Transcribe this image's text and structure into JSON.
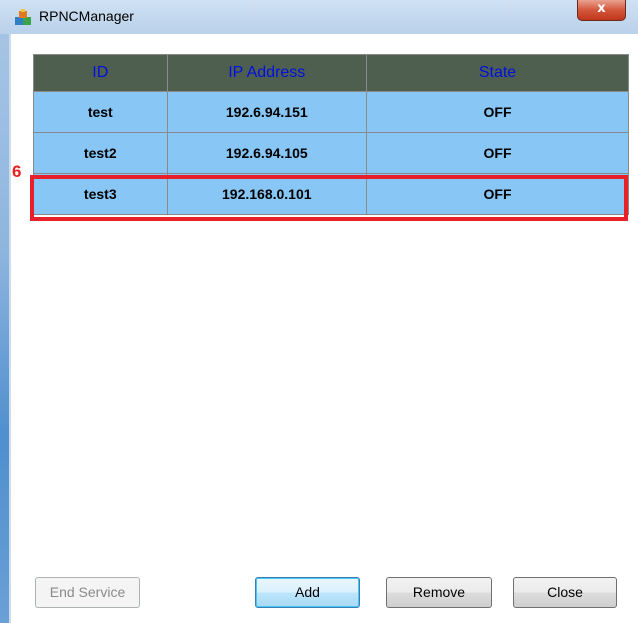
{
  "window": {
    "title": "RPNCManager",
    "close_glyph": "x"
  },
  "table": {
    "headers": [
      "ID",
      "IP Address",
      "State"
    ],
    "rows": [
      {
        "id": "test",
        "ip": "192.6.94.151",
        "state": "OFF"
      },
      {
        "id": "test2",
        "ip": "192.6.94.105",
        "state": "OFF"
      },
      {
        "id": "test3",
        "ip": "192.168.0.101",
        "state": "OFF"
      }
    ]
  },
  "annotation": {
    "step_number": "6"
  },
  "buttons": {
    "end_service": "End Service",
    "add": "Add",
    "remove": "Remove",
    "close": "Close"
  },
  "colors": {
    "header_bg": "#4f5f4f",
    "header_text": "#0010e0",
    "row_bg": "#87c6f5",
    "highlight": "#e8202a"
  }
}
